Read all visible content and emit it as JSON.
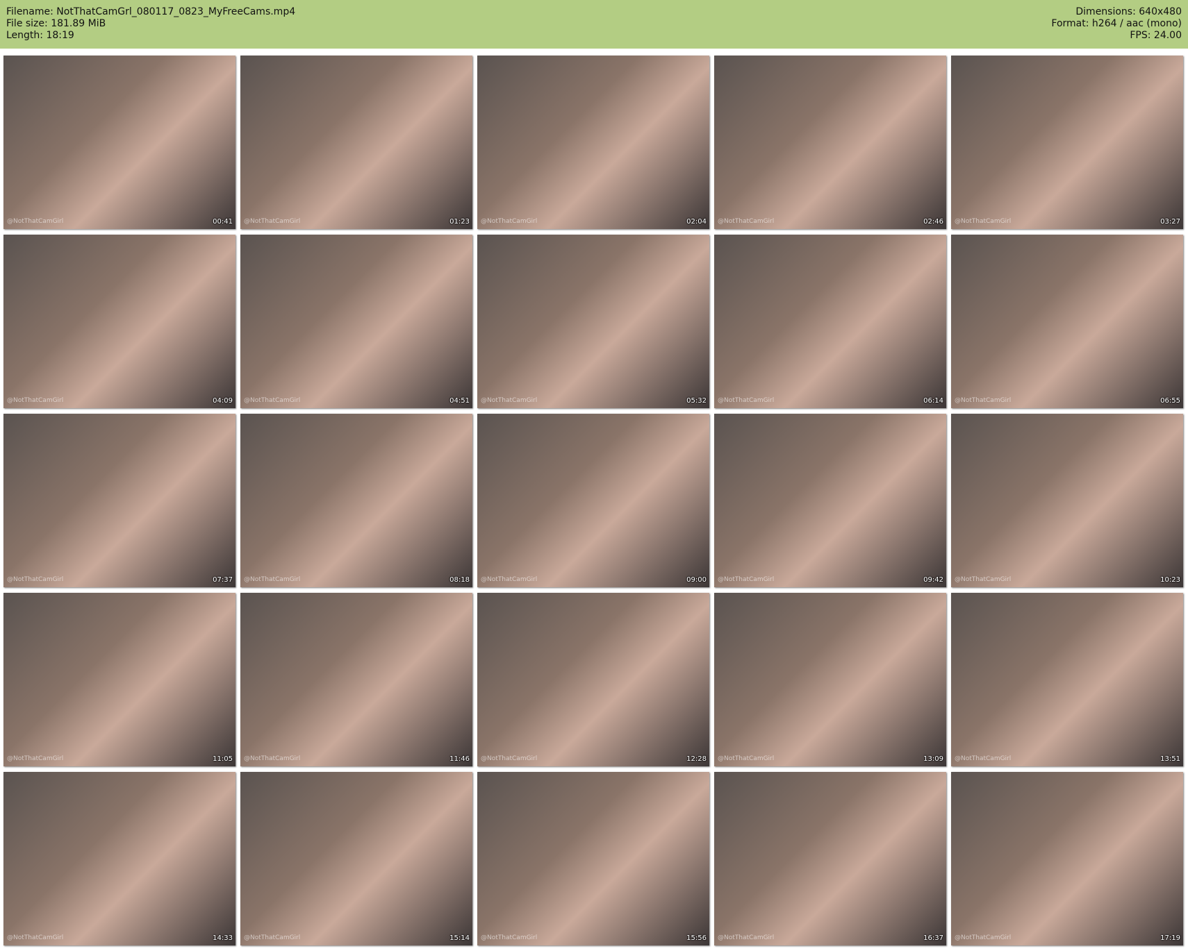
{
  "header": {
    "filename": "Filename: NotThatCamGrl_080117_0823_MyFreeCams.mp4",
    "filesize": "File size: 181.89 MiB",
    "length": "Length: 18:19",
    "dimensions": "Dimensions: 640x480",
    "format": "Format: h264 / aac (mono)",
    "fps": "FPS: 24.00"
  },
  "watermark": "@NotThatCamGirl",
  "thumbnails": [
    "00:41",
    "01:23",
    "02:04",
    "02:46",
    "03:27",
    "04:09",
    "04:51",
    "05:32",
    "06:14",
    "06:55",
    "07:37",
    "08:18",
    "09:00",
    "09:42",
    "10:23",
    "11:05",
    "11:46",
    "12:28",
    "13:09",
    "13:51",
    "14:33",
    "15:14",
    "15:56",
    "16:37",
    "17:19"
  ]
}
